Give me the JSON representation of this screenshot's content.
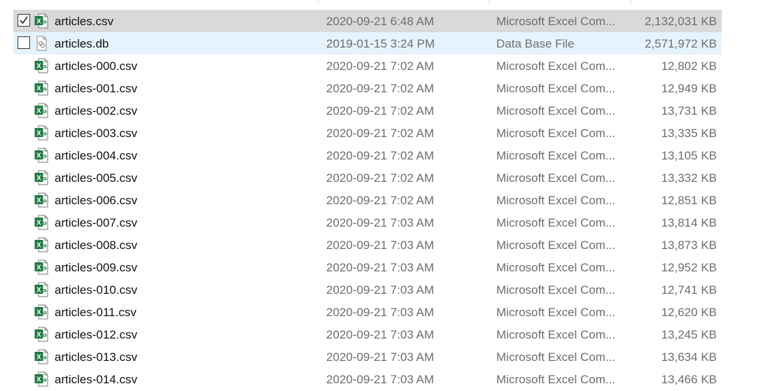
{
  "files": [
    {
      "name": "articles.csv",
      "date": "2020-09-21 6:48 AM",
      "type": "Microsoft Excel Com...",
      "size": "2,132,031 KB",
      "icon": "excel-csv-icon",
      "state": "selected",
      "checked": true
    },
    {
      "name": "articles.db",
      "date": "2019-01-15 3:24 PM",
      "type": "Data Base File",
      "size": "2,571,972 KB",
      "icon": "database-file-icon",
      "state": "hover",
      "checked": false
    },
    {
      "name": "articles-000.csv",
      "date": "2020-09-21 7:02 AM",
      "type": "Microsoft Excel Com...",
      "size": "12,802 KB",
      "icon": "excel-csv-icon"
    },
    {
      "name": "articles-001.csv",
      "date": "2020-09-21 7:02 AM",
      "type": "Microsoft Excel Com...",
      "size": "12,949 KB",
      "icon": "excel-csv-icon"
    },
    {
      "name": "articles-002.csv",
      "date": "2020-09-21 7:02 AM",
      "type": "Microsoft Excel Com...",
      "size": "13,731 KB",
      "icon": "excel-csv-icon"
    },
    {
      "name": "articles-003.csv",
      "date": "2020-09-21 7:02 AM",
      "type": "Microsoft Excel Com...",
      "size": "13,335 KB",
      "icon": "excel-csv-icon"
    },
    {
      "name": "articles-004.csv",
      "date": "2020-09-21 7:02 AM",
      "type": "Microsoft Excel Com...",
      "size": "13,105 KB",
      "icon": "excel-csv-icon"
    },
    {
      "name": "articles-005.csv",
      "date": "2020-09-21 7:02 AM",
      "type": "Microsoft Excel Com...",
      "size": "13,332 KB",
      "icon": "excel-csv-icon"
    },
    {
      "name": "articles-006.csv",
      "date": "2020-09-21 7:02 AM",
      "type": "Microsoft Excel Com...",
      "size": "12,851 KB",
      "icon": "excel-csv-icon"
    },
    {
      "name": "articles-007.csv",
      "date": "2020-09-21 7:03 AM",
      "type": "Microsoft Excel Com...",
      "size": "13,814 KB",
      "icon": "excel-csv-icon"
    },
    {
      "name": "articles-008.csv",
      "date": "2020-09-21 7:03 AM",
      "type": "Microsoft Excel Com...",
      "size": "13,873 KB",
      "icon": "excel-csv-icon"
    },
    {
      "name": "articles-009.csv",
      "date": "2020-09-21 7:03 AM",
      "type": "Microsoft Excel Com...",
      "size": "12,952 KB",
      "icon": "excel-csv-icon"
    },
    {
      "name": "articles-010.csv",
      "date": "2020-09-21 7:03 AM",
      "type": "Microsoft Excel Com...",
      "size": "12,741 KB",
      "icon": "excel-csv-icon"
    },
    {
      "name": "articles-011.csv",
      "date": "2020-09-21 7:03 AM",
      "type": "Microsoft Excel Com...",
      "size": "12,620 KB",
      "icon": "excel-csv-icon"
    },
    {
      "name": "articles-012.csv",
      "date": "2020-09-21 7:03 AM",
      "type": "Microsoft Excel Com...",
      "size": "13,245 KB",
      "icon": "excel-csv-icon"
    },
    {
      "name": "articles-013.csv",
      "date": "2020-09-21 7:03 AM",
      "type": "Microsoft Excel Com...",
      "size": "13,634 KB",
      "icon": "excel-csv-icon"
    },
    {
      "name": "articles-014.csv",
      "date": "2020-09-21 7:03 AM",
      "type": "Microsoft Excel Com...",
      "size": "13,466 KB",
      "icon": "excel-csv-icon"
    }
  ],
  "colors": {
    "selected_row": "#d9d9d9",
    "hover_row": "#e5f3ff",
    "excel_green": "#1d7a44",
    "secondary_text": "#6d6d6d"
  }
}
